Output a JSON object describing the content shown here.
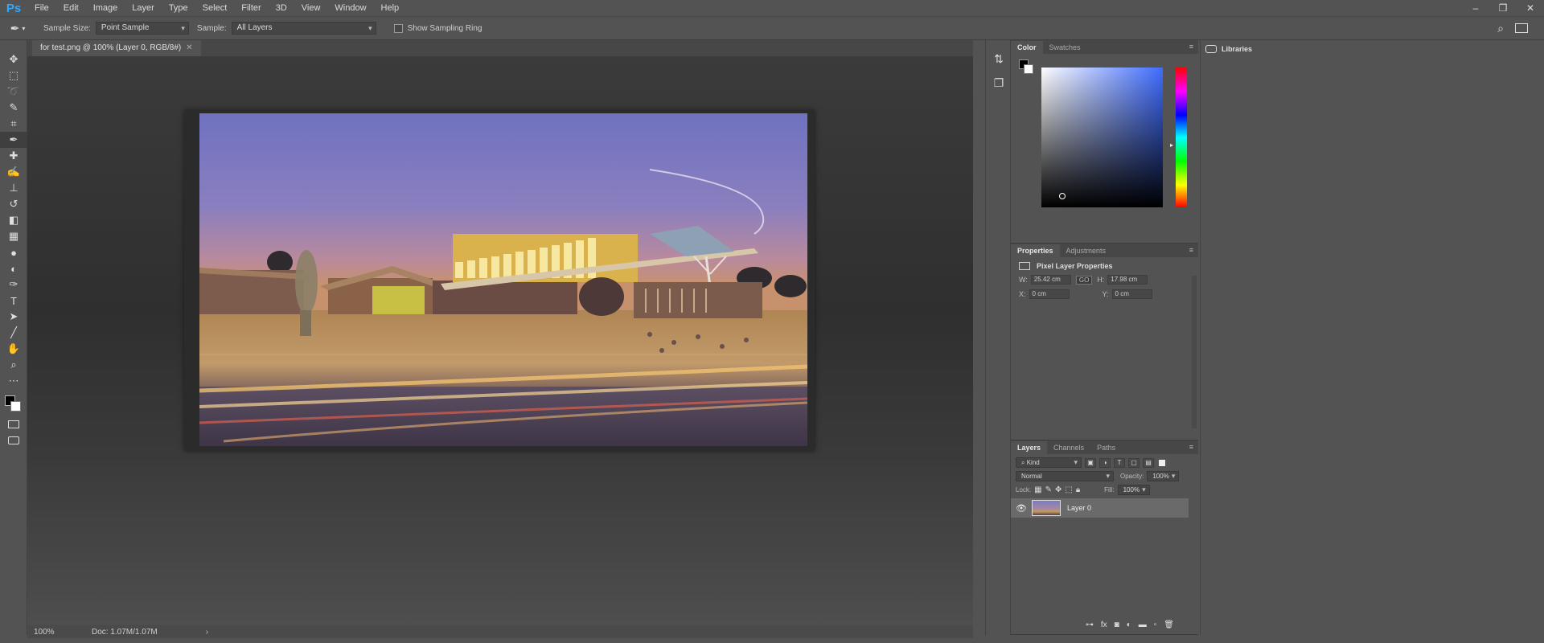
{
  "app": {
    "logo": "Ps"
  },
  "menu": [
    "File",
    "Edit",
    "Image",
    "Layer",
    "Type",
    "Select",
    "Filter",
    "3D",
    "View",
    "Window",
    "Help"
  ],
  "window_controls": [
    "–",
    "❐",
    "✕"
  ],
  "options": {
    "sample_size_label": "Sample Size:",
    "sample_size_value": "Point Sample",
    "sample_label": "Sample:",
    "sample_value": "All Layers",
    "show_ring_label": "Show Sampling Ring"
  },
  "tools": [
    {
      "icon": "move-icon",
      "glyph": "✥"
    },
    {
      "icon": "marquee-icon",
      "glyph": "⬚"
    },
    {
      "icon": "lasso-icon",
      "glyph": "➰"
    },
    {
      "icon": "quick-select-icon",
      "glyph": "✎"
    },
    {
      "icon": "crop-icon",
      "glyph": "⌗"
    },
    {
      "icon": "eyedropper-icon",
      "glyph": "✒"
    },
    {
      "icon": "healing-icon",
      "glyph": "✚"
    },
    {
      "icon": "brush-icon",
      "glyph": "✍"
    },
    {
      "icon": "stamp-icon",
      "glyph": "⊥"
    },
    {
      "icon": "history-brush-icon",
      "glyph": "↺"
    },
    {
      "icon": "eraser-icon",
      "glyph": "◧"
    },
    {
      "icon": "gradient-icon",
      "glyph": "▦"
    },
    {
      "icon": "blur-icon",
      "glyph": "●"
    },
    {
      "icon": "dodge-icon",
      "glyph": "◐"
    },
    {
      "icon": "pen-icon",
      "glyph": "✑"
    },
    {
      "icon": "type-icon",
      "glyph": "T"
    },
    {
      "icon": "path-select-icon",
      "glyph": "➤"
    },
    {
      "icon": "shape-icon",
      "glyph": "╱"
    },
    {
      "icon": "hand-icon",
      "glyph": "✋"
    },
    {
      "icon": "zoom-icon",
      "glyph": "⌕"
    },
    {
      "icon": "more-tools-icon",
      "glyph": "⋯"
    }
  ],
  "document": {
    "tab_title": "for test.png @ 100% (Layer 0, RGB/8#)",
    "zoom": "100%",
    "doc_info": "Doc: 1.07M/1.07M"
  },
  "color_panel": {
    "tabs": [
      "Color",
      "Swatches"
    ]
  },
  "properties_panel": {
    "tabs": [
      "Properties",
      "Adjustments"
    ],
    "heading": "Pixel Layer Properties",
    "w_label": "W:",
    "w_value": "25.42 cm",
    "go_label": "GO",
    "h_label": "H:",
    "h_value": "17.98 cm",
    "x_label": "X:",
    "x_value": "0 cm",
    "y_label": "Y:",
    "y_value": "0 cm"
  },
  "layers_panel": {
    "tabs": [
      "Layers",
      "Channels",
      "Paths"
    ],
    "kind": "Kind",
    "blend_mode": "Normal",
    "opacity_label": "Opacity:",
    "opacity_value": "100%",
    "lock_label": "Lock:",
    "fill_label": "Fill:",
    "fill_value": "100%",
    "layers": [
      {
        "name": "Layer 0",
        "visible": true
      }
    ]
  },
  "libraries": {
    "label": "Libraries"
  }
}
